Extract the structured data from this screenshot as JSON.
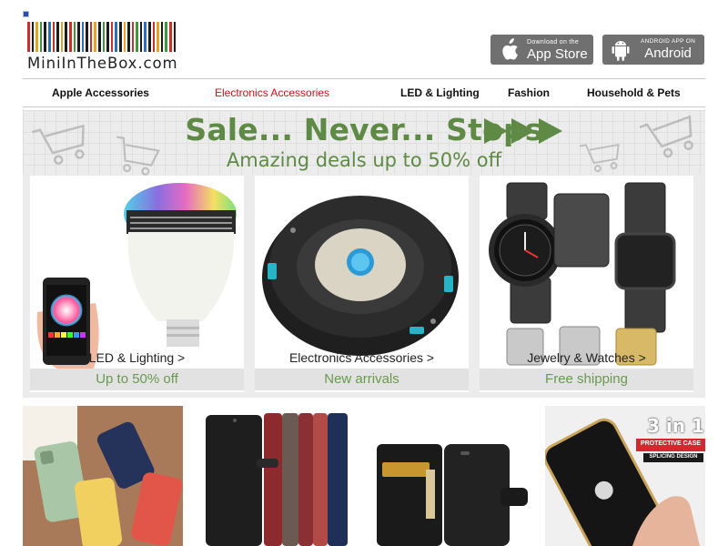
{
  "logo": {
    "text": "MiniInTheBox.com",
    "barcode_colors": [
      "#c8302b",
      "#1b1b1b",
      "#e8a224",
      "#3c9a3a",
      "#1b1b1b",
      "#2f6fb8",
      "#c8302b",
      "#1b1b1b",
      "#e8a224",
      "#1b1b1b",
      "#c8302b",
      "#3c9a3a",
      "#1b1b1b",
      "#2f6fb8",
      "#1b1b1b",
      "#c8302b",
      "#e8a224",
      "#1b1b1b",
      "#3c9a3a",
      "#1b1b1b",
      "#c8302b",
      "#2f6fb8",
      "#1b1b1b",
      "#e8a224",
      "#1b1b1b",
      "#c8302b",
      "#3c9a3a",
      "#1b1b1b",
      "#2f6fb8",
      "#1b1b1b",
      "#c8302b",
      "#e8a224",
      "#1b1b1b",
      "#3c9a3a",
      "#c8302b",
      "#1b1b1b"
    ]
  },
  "app_badges": {
    "apple": {
      "small": "Download on the",
      "big": "App Store"
    },
    "android": {
      "small": "ANDROID APP ON",
      "big": "Android"
    }
  },
  "nav": {
    "items": [
      {
        "label": "Apple Accessories"
      },
      {
        "label": "Electronics Accessories"
      },
      {
        "label": "LED & Lighting"
      },
      {
        "label": "Fashion"
      },
      {
        "label": "Household & Pets"
      }
    ],
    "active_color": "#c4141b"
  },
  "sale_banner": {
    "title": "Sale... Never... Stops",
    "subtitle": "Amazing deals up to 50% off",
    "accent": "#5e8a45",
    "tiles": [
      {
        "label": "LED & Lighting >",
        "caption": "Up to 50% off",
        "image": "smart-bulb-image"
      },
      {
        "label": "Electronics Accessories >",
        "caption": "New arrivals",
        "image": "robot-vacuum-image"
      },
      {
        "label": "Jewelry & Watches >",
        "caption": "Free shipping",
        "image": "smart-watch-image"
      }
    ]
  },
  "products": [
    {
      "image": "colorful-phone-cases-image"
    },
    {
      "image": "leather-wallet-cases-image"
    },
    {
      "image": "black-wallet-case-image"
    },
    {
      "image": "three-in-one-case-image",
      "badge_big": "3 in 1",
      "badge_mid": "PROTECTIVE CASE",
      "badge_small": "SPLICING DESIGN"
    }
  ]
}
